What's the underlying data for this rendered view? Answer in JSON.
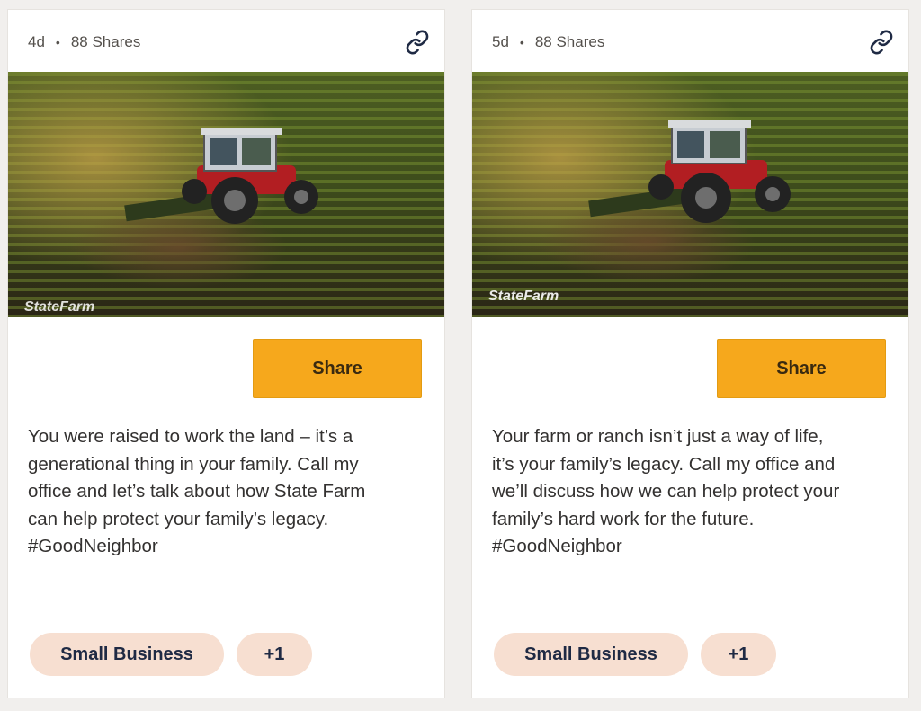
{
  "colors": {
    "share_button": "#f6a81c",
    "tag_background": "#f7dfd1",
    "tag_text": "#1f2a44",
    "page_background": "#f1efed"
  },
  "cards": [
    {
      "age": "4d",
      "separator": "•",
      "shares": "88 Shares",
      "link_icon": "link-icon",
      "image_logo": "StateFarm",
      "share_label": "Share",
      "body_lines": [
        "You were raised to work the land – it’s a",
        "generational thing in your family. Call my",
        "office and let’s talk about how State Farm",
        "can help protect your family’s legacy.",
        "#GoodNeighbor"
      ],
      "tags": [
        "Small Business",
        "+1"
      ]
    },
    {
      "age": "5d",
      "separator": "•",
      "shares": "88 Shares",
      "link_icon": "link-icon",
      "image_logo": "StateFarm",
      "share_label": "Share",
      "body_lines": [
        "Your farm or ranch isn’t just a way of life,",
        "it’s your family’s legacy. Call my office and",
        "we’ll discuss how we can help protect your",
        "family’s hard work for the future.",
        "#GoodNeighbor"
      ],
      "tags": [
        "Small Business",
        "+1"
      ]
    }
  ]
}
